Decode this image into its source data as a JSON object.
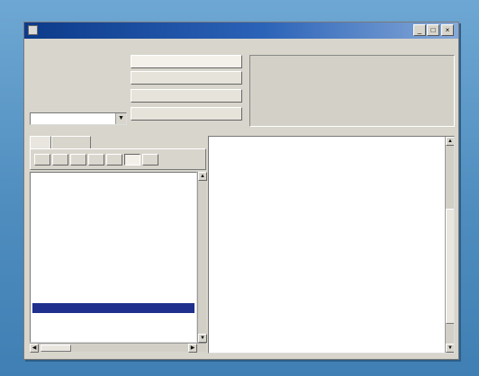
{
  "window": {
    "title": "",
    "minimize_label": "_",
    "maximize_label": "□",
    "close_label": "×"
  },
  "menu": [
    "",
    "",
    "",
    ""
  ],
  "date_panel": {
    "line1": "",
    "line2": "",
    "line3": "",
    "clock": ""
  },
  "city_combo": {
    "value": "",
    "arrow": "▼"
  },
  "buttons": [
    "",
    "",
    "",
    ""
  ],
  "tabs": [
    "",
    ""
  ],
  "days": [
    "",
    "",
    "",
    "",
    "",
    "",
    ""
  ],
  "channels": [
    {
      "name": "",
      "selected": false
    },
    {
      "name": "",
      "selected": false
    },
    {
      "name": "",
      "selected": false
    },
    {
      "name": "",
      "selected": false
    },
    {
      "name": "",
      "selected": false
    },
    {
      "name": "",
      "selected": false
    },
    {
      "name": "",
      "selected": false
    },
    {
      "name": "",
      "selected": false
    },
    {
      "name": "",
      "selected": false
    },
    {
      "name": "",
      "selected": false
    },
    {
      "name": "",
      "selected": false
    },
    {
      "name": "",
      "selected": false
    },
    {
      "name": "",
      "selected": false
    },
    {
      "name": "",
      "selected": true
    },
    {
      "name": "",
      "selected": false
    },
    {
      "name": "",
      "selected": false
    },
    {
      "name": "",
      "selected": false
    },
    {
      "name": "",
      "selected": false
    },
    {
      "name": "",
      "selected": false
    },
    {
      "name": "",
      "selected": false
    }
  ],
  "programs": [
    {
      "text": "",
      "style": "normal"
    },
    {
      "text": "",
      "style": "normal"
    },
    {
      "text": "",
      "style": "highlight"
    },
    {
      "text": "",
      "style": "normal"
    },
    {
      "text": "",
      "style": "normal"
    },
    {
      "text": "",
      "style": "normal"
    },
    {
      "text": "",
      "style": "normal"
    },
    {
      "text": "",
      "style": "normal"
    },
    {
      "text": "",
      "style": "normal"
    },
    {
      "text": "",
      "style": "normal"
    },
    {
      "text": "",
      "style": "normal"
    },
    {
      "text": "",
      "style": "normal"
    },
    {
      "text": "",
      "style": "normal"
    },
    {
      "text": "",
      "style": "normal"
    },
    {
      "text": "",
      "style": "normal"
    },
    {
      "text": "",
      "style": "bold"
    },
    {
      "text": "",
      "style": "normal"
    },
    {
      "text": "",
      "style": "bold"
    },
    {
      "text": "",
      "style": "normal"
    }
  ],
  "icons": {
    "app": "tv-app-icon",
    "scroll_up": "▲",
    "scroll_down": "▼",
    "scroll_left": "◀",
    "scroll_right": "▶"
  },
  "colors": {
    "background": "#5a95c2",
    "titlebar": "#0c3a8a",
    "selection": "#1f2f8e",
    "highlight": "#0d0d0d"
  }
}
